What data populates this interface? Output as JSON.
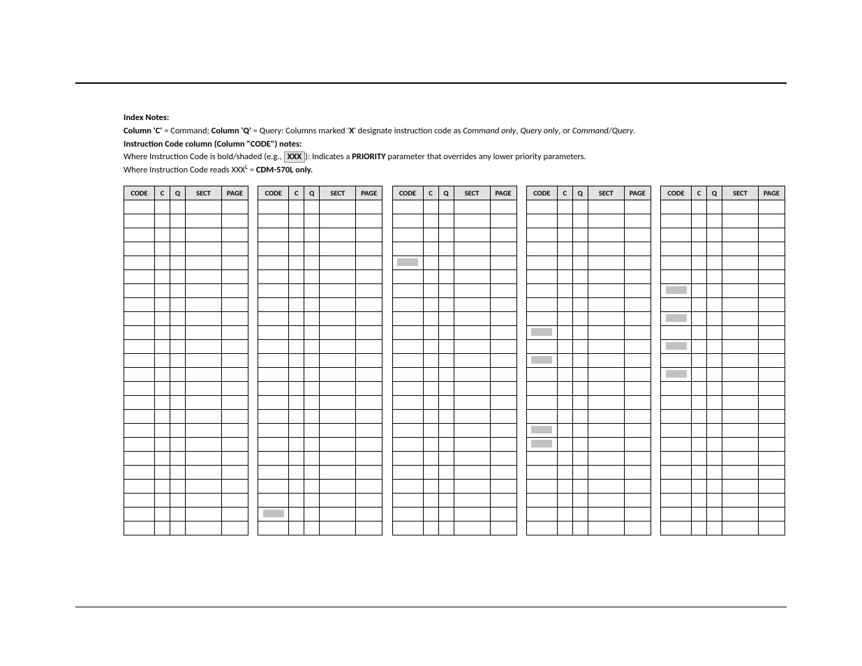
{
  "notes": {
    "heading": "Index Notes:",
    "line1_prefix": "Column 'C'",
    "line1_mid1": " = Command; ",
    "line1_colq": "Column 'Q'",
    "line1_mid2": " = Query: Columns marked '",
    "line1_x": "X",
    "line1_mid3": "' designate instruction code as ",
    "line1_cmd_only": "Command only",
    "line1_comma1": ", ",
    "line1_query_only": "Query only",
    "line1_or": ", or ",
    "line1_cmd_query": "Command/Query",
    "line1_period": ".",
    "line2": "Instruction Code column (Column \"CODE\") notes:",
    "line3_a": "Where Instruction Code is bold/shaded (e.g., ",
    "line3_xxx": "XXX",
    "line3_b": "): Indicates a ",
    "line3_priority": "PRIORITY",
    "line3_c": " parameter that overrides any lower priority parameters.",
    "line4_a": "Where Instruction Code reads XXX",
    "line4_sup": "L",
    "line4_b": " = ",
    "line4_bold": "CDM-570L only."
  },
  "headers": [
    "CODE",
    "C",
    "Q",
    "SECT",
    "PAGE"
  ],
  "tables": [
    {
      "rows": [
        {
          "code": "",
          "c": "",
          "q": "",
          "sect": "",
          "page": "",
          "priority": false
        },
        {
          "code": "",
          "c": "",
          "q": "",
          "sect": "",
          "page": "",
          "priority": false
        },
        {
          "code": "",
          "c": "",
          "q": "",
          "sect": "",
          "page": "",
          "priority": false
        },
        {
          "code": "",
          "c": "",
          "q": "",
          "sect": "",
          "page": "",
          "priority": false
        },
        {
          "code": "",
          "c": "",
          "q": "",
          "sect": "",
          "page": "",
          "priority": false
        },
        {
          "code": "",
          "c": "",
          "q": "",
          "sect": "",
          "page": "",
          "priority": false
        },
        {
          "code": "",
          "c": "",
          "q": "",
          "sect": "",
          "page": "",
          "priority": false
        },
        {
          "code": "",
          "c": "",
          "q": "",
          "sect": "",
          "page": "",
          "priority": false
        },
        {
          "code": "",
          "c": "",
          "q": "",
          "sect": "",
          "page": "",
          "priority": false
        },
        {
          "code": "",
          "c": "",
          "q": "",
          "sect": "",
          "page": "",
          "priority": false
        },
        {
          "code": "",
          "c": "",
          "q": "",
          "sect": "",
          "page": "",
          "priority": false
        },
        {
          "code": "",
          "c": "",
          "q": "",
          "sect": "",
          "page": "",
          "priority": false
        },
        {
          "code": "",
          "c": "",
          "q": "",
          "sect": "",
          "page": "",
          "priority": false
        },
        {
          "code": "",
          "c": "",
          "q": "",
          "sect": "",
          "page": "",
          "priority": false
        },
        {
          "code": "",
          "c": "",
          "q": "",
          "sect": "",
          "page": "",
          "priority": false
        },
        {
          "code": "",
          "c": "",
          "q": "",
          "sect": "",
          "page": "",
          "priority": false
        },
        {
          "code": "",
          "c": "",
          "q": "",
          "sect": "",
          "page": "",
          "priority": false
        },
        {
          "code": "",
          "c": "",
          "q": "",
          "sect": "",
          "page": "",
          "priority": false
        },
        {
          "code": "",
          "c": "",
          "q": "",
          "sect": "",
          "page": "",
          "priority": false
        },
        {
          "code": "",
          "c": "",
          "q": "",
          "sect": "",
          "page": "",
          "priority": false
        },
        {
          "code": "",
          "c": "",
          "q": "",
          "sect": "",
          "page": "",
          "priority": false
        },
        {
          "code": "",
          "c": "",
          "q": "",
          "sect": "",
          "page": "",
          "priority": false
        },
        {
          "code": "",
          "c": "",
          "q": "",
          "sect": "",
          "page": "",
          "priority": false
        },
        {
          "code": "",
          "c": "",
          "q": "",
          "sect": "",
          "page": "",
          "priority": false
        }
      ]
    },
    {
      "rows": [
        {
          "code": "",
          "c": "",
          "q": "",
          "sect": "",
          "page": "",
          "priority": false
        },
        {
          "code": "",
          "c": "",
          "q": "",
          "sect": "",
          "page": "",
          "priority": false
        },
        {
          "code": "",
          "c": "",
          "q": "",
          "sect": "",
          "page": "",
          "priority": false
        },
        {
          "code": "",
          "c": "",
          "q": "",
          "sect": "",
          "page": "",
          "priority": false
        },
        {
          "code": "",
          "c": "",
          "q": "",
          "sect": "",
          "page": "",
          "priority": false
        },
        {
          "code": "",
          "c": "",
          "q": "",
          "sect": "",
          "page": "",
          "priority": false
        },
        {
          "code": "",
          "c": "",
          "q": "",
          "sect": "",
          "page": "",
          "priority": false
        },
        {
          "code": "",
          "c": "",
          "q": "",
          "sect": "",
          "page": "",
          "priority": false
        },
        {
          "code": "",
          "c": "",
          "q": "",
          "sect": "",
          "page": "",
          "priority": false
        },
        {
          "code": "",
          "c": "",
          "q": "",
          "sect": "",
          "page": "",
          "priority": false
        },
        {
          "code": "",
          "c": "",
          "q": "",
          "sect": "",
          "page": "",
          "priority": false
        },
        {
          "code": "",
          "c": "",
          "q": "",
          "sect": "",
          "page": "",
          "priority": false
        },
        {
          "code": "",
          "c": "",
          "q": "",
          "sect": "",
          "page": "",
          "priority": false
        },
        {
          "code": "",
          "c": "",
          "q": "",
          "sect": "",
          "page": "",
          "priority": false
        },
        {
          "code": "",
          "c": "",
          "q": "",
          "sect": "",
          "page": "",
          "priority": false
        },
        {
          "code": "",
          "c": "",
          "q": "",
          "sect": "",
          "page": "",
          "priority": false
        },
        {
          "code": "",
          "c": "",
          "q": "",
          "sect": "",
          "page": "",
          "priority": false
        },
        {
          "code": "",
          "c": "",
          "q": "",
          "sect": "",
          "page": "",
          "priority": false
        },
        {
          "code": "",
          "c": "",
          "q": "",
          "sect": "",
          "page": "",
          "priority": false
        },
        {
          "code": "",
          "c": "",
          "q": "",
          "sect": "",
          "page": "",
          "priority": false
        },
        {
          "code": "",
          "c": "",
          "q": "",
          "sect": "",
          "page": "",
          "priority": false
        },
        {
          "code": "",
          "c": "",
          "q": "",
          "sect": "",
          "page": "",
          "priority": false
        },
        {
          "code": " ",
          "c": "",
          "q": "",
          "sect": "",
          "page": "",
          "priority": true
        },
        {
          "code": "",
          "c": "",
          "q": "",
          "sect": "",
          "page": "",
          "priority": false
        }
      ]
    },
    {
      "rows": [
        {
          "code": "",
          "c": "",
          "q": "",
          "sect": "",
          "page": "",
          "priority": false
        },
        {
          "code": "",
          "c": "",
          "q": "",
          "sect": "",
          "page": "",
          "priority": false
        },
        {
          "code": "",
          "c": "",
          "q": "",
          "sect": "",
          "page": "",
          "priority": false
        },
        {
          "code": "",
          "c": "",
          "q": "",
          "sect": "",
          "page": "",
          "priority": false
        },
        {
          "code": " ",
          "c": "",
          "q": "",
          "sect": "",
          "page": "",
          "priority": true
        },
        {
          "code": "",
          "c": "",
          "q": "",
          "sect": "",
          "page": "",
          "priority": false
        },
        {
          "code": "",
          "c": "",
          "q": "",
          "sect": "",
          "page": "",
          "priority": false
        },
        {
          "code": "",
          "c": "",
          "q": "",
          "sect": "",
          "page": "",
          "priority": false
        },
        {
          "code": "",
          "c": "",
          "q": "",
          "sect": "",
          "page": "",
          "priority": false
        },
        {
          "code": "",
          "c": "",
          "q": "",
          "sect": "",
          "page": "",
          "priority": false
        },
        {
          "code": "",
          "c": "",
          "q": "",
          "sect": "",
          "page": "",
          "priority": false
        },
        {
          "code": "",
          "c": "",
          "q": "",
          "sect": "",
          "page": "",
          "priority": false
        },
        {
          "code": "",
          "c": "",
          "q": "",
          "sect": "",
          "page": "",
          "priority": false
        },
        {
          "code": "",
          "c": "",
          "q": "",
          "sect": "",
          "page": "",
          "priority": false
        },
        {
          "code": "",
          "c": "",
          "q": "",
          "sect": "",
          "page": "",
          "priority": false
        },
        {
          "code": "",
          "c": "",
          "q": "",
          "sect": "",
          "page": "",
          "priority": false
        },
        {
          "code": "",
          "c": "",
          "q": "",
          "sect": "",
          "page": "",
          "priority": false
        },
        {
          "code": "",
          "c": "",
          "q": "",
          "sect": "",
          "page": "",
          "priority": false
        },
        {
          "code": "",
          "c": "",
          "q": "",
          "sect": "",
          "page": "",
          "priority": false
        },
        {
          "code": "",
          "c": "",
          "q": "",
          "sect": "",
          "page": "",
          "priority": false
        },
        {
          "code": "",
          "c": "",
          "q": "",
          "sect": "",
          "page": "",
          "priority": false
        },
        {
          "code": "",
          "c": "",
          "q": "",
          "sect": "",
          "page": "",
          "priority": false
        },
        {
          "code": "",
          "c": "",
          "q": "",
          "sect": "",
          "page": "",
          "priority": false
        },
        {
          "code": "",
          "c": "",
          "q": "",
          "sect": "",
          "page": "",
          "priority": false
        }
      ]
    },
    {
      "rows": [
        {
          "code": "",
          "c": "",
          "q": "",
          "sect": "",
          "page": "",
          "priority": false
        },
        {
          "code": "",
          "c": "",
          "q": "",
          "sect": "",
          "page": "",
          "priority": false
        },
        {
          "code": "",
          "c": "",
          "q": "",
          "sect": "",
          "page": "",
          "priority": false
        },
        {
          "code": "",
          "c": "",
          "q": "",
          "sect": "",
          "page": "",
          "priority": false
        },
        {
          "code": "",
          "c": "",
          "q": "",
          "sect": "",
          "page": "",
          "priority": false
        },
        {
          "code": "",
          "c": "",
          "q": "",
          "sect": "",
          "page": "",
          "priority": false
        },
        {
          "code": "",
          "c": "",
          "q": "",
          "sect": "",
          "page": "",
          "priority": false
        },
        {
          "code": "",
          "c": "",
          "q": "",
          "sect": "",
          "page": "",
          "priority": false
        },
        {
          "code": "",
          "c": "",
          "q": "",
          "sect": "",
          "page": "",
          "priority": false
        },
        {
          "code": " ",
          "c": "",
          "q": "",
          "sect": "",
          "page": "",
          "priority": true
        },
        {
          "code": "",
          "c": "",
          "q": "",
          "sect": "",
          "page": "",
          "priority": false
        },
        {
          "code": " ",
          "c": "",
          "q": "",
          "sect": "",
          "page": "",
          "priority": true
        },
        {
          "code": "",
          "c": "",
          "q": "",
          "sect": "",
          "page": "",
          "priority": false
        },
        {
          "code": "",
          "c": "",
          "q": "",
          "sect": "",
          "page": "",
          "priority": false
        },
        {
          "code": "",
          "c": "",
          "q": "",
          "sect": "",
          "page": "",
          "priority": false
        },
        {
          "code": "",
          "c": "",
          "q": "",
          "sect": "",
          "page": "",
          "priority": false
        },
        {
          "code": " ",
          "c": "",
          "q": "",
          "sect": "",
          "page": "",
          "priority": true
        },
        {
          "code": " ",
          "c": "",
          "q": "",
          "sect": "",
          "page": "",
          "priority": true
        },
        {
          "code": "",
          "c": "",
          "q": "",
          "sect": "",
          "page": "",
          "priority": false
        },
        {
          "code": "",
          "c": "",
          "q": "",
          "sect": "",
          "page": "",
          "priority": false
        },
        {
          "code": "",
          "c": "",
          "q": "",
          "sect": "",
          "page": "",
          "priority": false
        },
        {
          "code": "",
          "c": "",
          "q": "",
          "sect": "",
          "page": "",
          "priority": false
        },
        {
          "code": "",
          "c": "",
          "q": "",
          "sect": "",
          "page": "",
          "priority": false
        },
        {
          "code": "",
          "c": "",
          "q": "",
          "sect": "",
          "page": "",
          "priority": false
        }
      ]
    },
    {
      "rows": [
        {
          "code": "",
          "c": "",
          "q": "",
          "sect": "",
          "page": "",
          "priority": false
        },
        {
          "code": "",
          "c": "",
          "q": "",
          "sect": "",
          "page": "",
          "priority": false
        },
        {
          "code": "",
          "c": "",
          "q": "",
          "sect": "",
          "page": "",
          "priority": false
        },
        {
          "code": "",
          "c": "",
          "q": "",
          "sect": "",
          "page": "",
          "priority": false
        },
        {
          "code": "",
          "c": "",
          "q": "",
          "sect": "",
          "page": "",
          "priority": false
        },
        {
          "code": "",
          "c": "",
          "q": "",
          "sect": "",
          "page": "",
          "priority": false
        },
        {
          "code": " ",
          "c": "",
          "q": "",
          "sect": "",
          "page": "",
          "priority": true
        },
        {
          "code": "",
          "c": "",
          "q": "",
          "sect": "",
          "page": "",
          "priority": false
        },
        {
          "code": " ",
          "c": "",
          "q": "",
          "sect": "",
          "page": "",
          "priority": true
        },
        {
          "code": "",
          "c": "",
          "q": "",
          "sect": "",
          "page": "",
          "priority": false
        },
        {
          "code": " ",
          "c": "",
          "q": "",
          "sect": "",
          "page": "",
          "priority": true
        },
        {
          "code": "",
          "c": "",
          "q": "",
          "sect": "",
          "page": "",
          "priority": false
        },
        {
          "code": " ",
          "c": "",
          "q": "",
          "sect": "",
          "page": "",
          "priority": true
        },
        {
          "code": "",
          "c": "",
          "q": "",
          "sect": "",
          "page": "",
          "priority": false
        },
        {
          "code": "",
          "c": "",
          "q": "",
          "sect": "",
          "page": "",
          "priority": false
        },
        {
          "code": "",
          "c": "",
          "q": "",
          "sect": "",
          "page": "",
          "priority": false
        },
        {
          "code": "",
          "c": "",
          "q": "",
          "sect": "",
          "page": "",
          "priority": false
        },
        {
          "code": "",
          "c": "",
          "q": "",
          "sect": "",
          "page": "",
          "priority": false
        },
        {
          "code": "",
          "c": "",
          "q": "",
          "sect": "",
          "page": "",
          "priority": false
        },
        {
          "code": "",
          "c": "",
          "q": "",
          "sect": "",
          "page": "",
          "priority": false
        },
        {
          "code": "",
          "c": "",
          "q": "",
          "sect": "",
          "page": "",
          "priority": false
        },
        {
          "code": "",
          "c": "",
          "q": "",
          "sect": "",
          "page": "",
          "priority": false
        },
        {
          "code": "",
          "c": "",
          "q": "",
          "sect": "",
          "page": "",
          "priority": false
        },
        {
          "code": "",
          "c": "",
          "q": "",
          "sect": "",
          "page": "",
          "priority": false
        }
      ]
    }
  ]
}
